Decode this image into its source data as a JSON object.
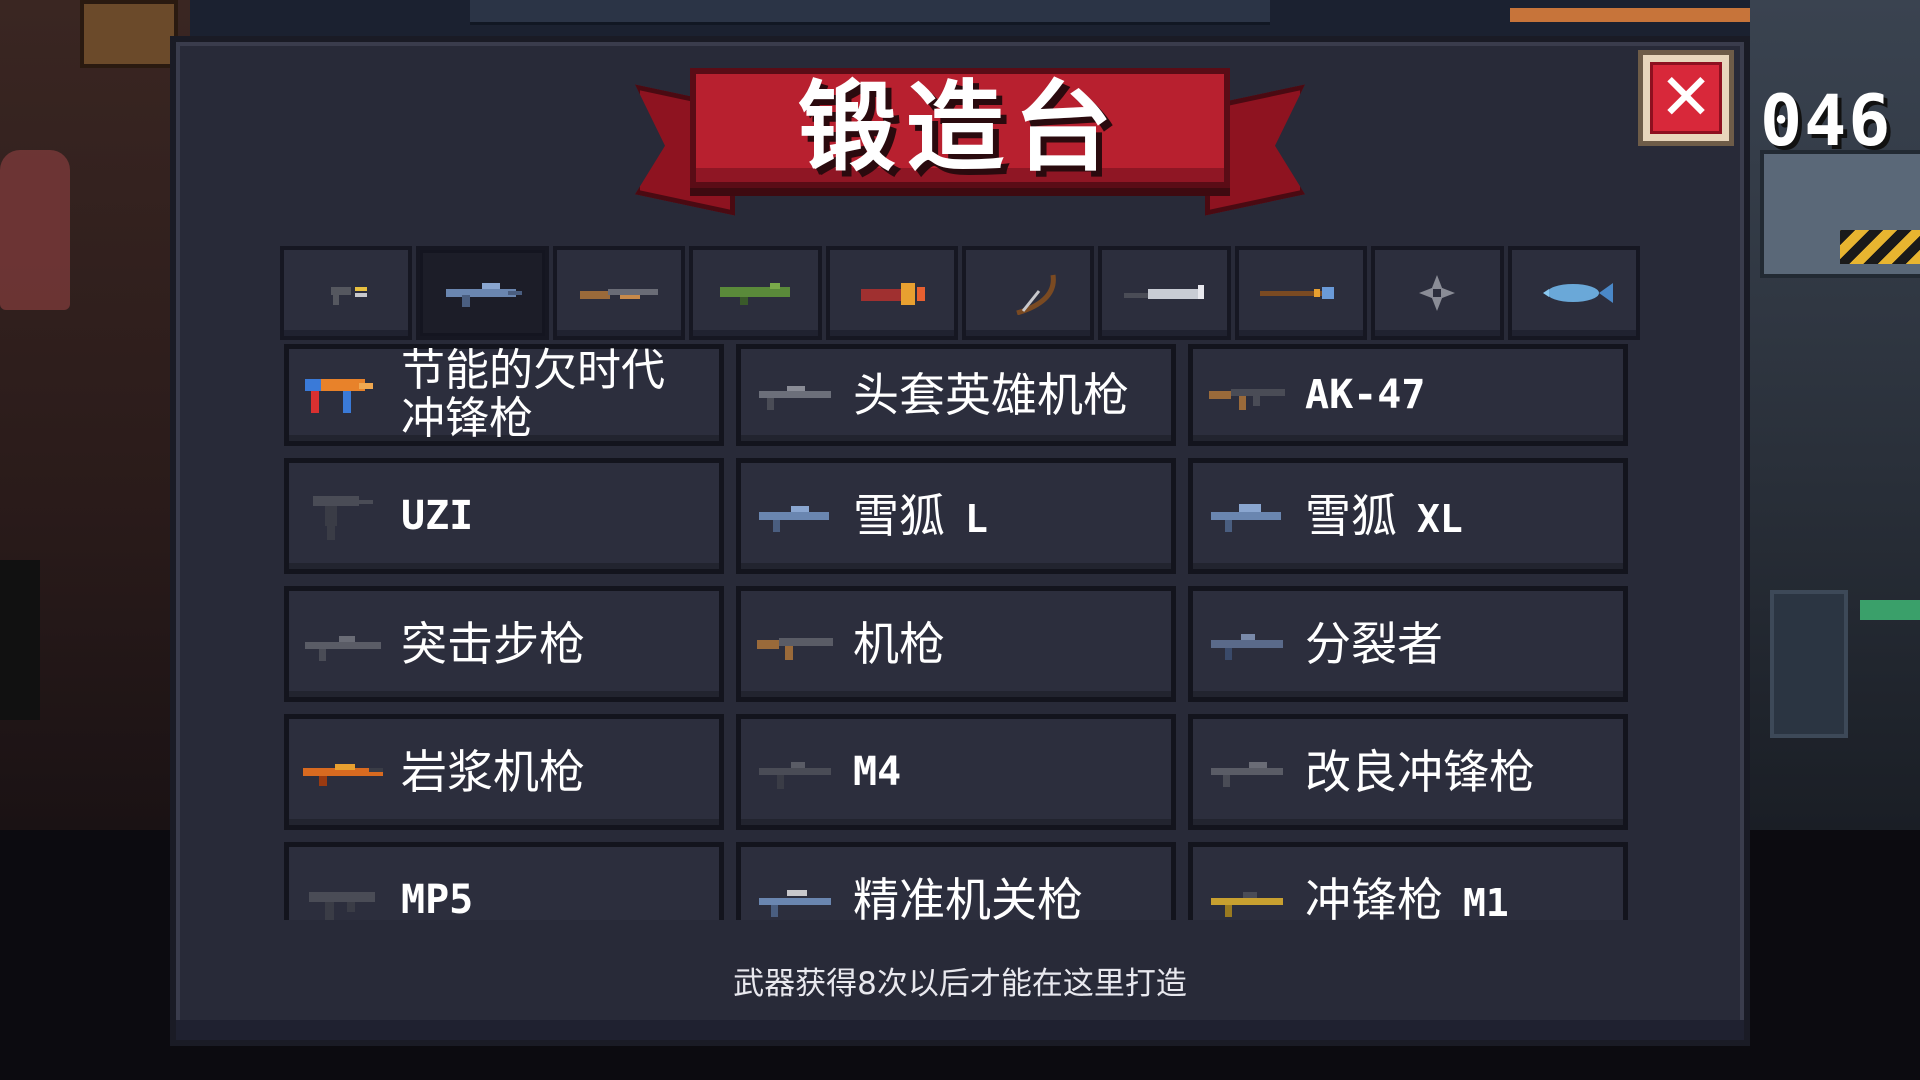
{
  "hud": {
    "score_partial": "046"
  },
  "dialog": {
    "title": "锻造台",
    "close_label": "✕",
    "hint": "武器获得8次以后才能在这里打造"
  },
  "tabs": [
    {
      "icon": "pistol-icon",
      "active": false
    },
    {
      "icon": "rifle-icon",
      "active": true
    },
    {
      "icon": "shotgun-icon",
      "active": false
    },
    {
      "icon": "launcher-icon",
      "active": false
    },
    {
      "icon": "special-gun-icon",
      "active": false
    },
    {
      "icon": "bow-icon",
      "active": false
    },
    {
      "icon": "sword-icon",
      "active": false
    },
    {
      "icon": "staff-icon",
      "active": false
    },
    {
      "icon": "shuriken-icon",
      "active": false
    },
    {
      "icon": "fish-icon",
      "active": false
    }
  ],
  "weapons": [
    {
      "name": "节能的欠时代冲锋枪",
      "icon": "energy-smg-icon",
      "color": "#e8822a"
    },
    {
      "name": "头套英雄机枪",
      "icon": "hood-hero-mg-icon",
      "color": "#6c6f7a"
    },
    {
      "name": "AK-47",
      "icon": "ak47-icon",
      "color": "#9a6a3a"
    },
    {
      "name": "UZI",
      "icon": "uzi-icon",
      "color": "#4a4c56"
    },
    {
      "name": "雪狐",
      "suffix": "L",
      "icon": "snow-fox-l-icon",
      "color": "#6a86b0"
    },
    {
      "name": "雪狐",
      "suffix": "XL",
      "icon": "snow-fox-xl-icon",
      "color": "#6a86b0"
    },
    {
      "name": "突击步枪",
      "icon": "assault-rifle-icon",
      "color": "#5a5c66"
    },
    {
      "name": "机枪",
      "icon": "machine-gun-icon",
      "color": "#9a6a3a"
    },
    {
      "name": "分裂者",
      "icon": "splitter-icon",
      "color": "#5a6a8a"
    },
    {
      "name": "岩浆机枪",
      "icon": "lava-mg-icon",
      "color": "#d86a20"
    },
    {
      "name": "M4",
      "icon": "m4-icon",
      "color": "#4a4c56"
    },
    {
      "name": "改良冲锋枪",
      "icon": "improved-smg-icon",
      "color": "#5a5c66"
    },
    {
      "name": "MP5",
      "icon": "mp5-icon",
      "color": "#4a4c56"
    },
    {
      "name": "精准机关枪",
      "icon": "precision-mg-icon",
      "color": "#6a86b0"
    },
    {
      "name": "冲锋枪",
      "suffix": "M1",
      "icon": "smg-m1-icon",
      "color": "#c8a030"
    }
  ]
}
